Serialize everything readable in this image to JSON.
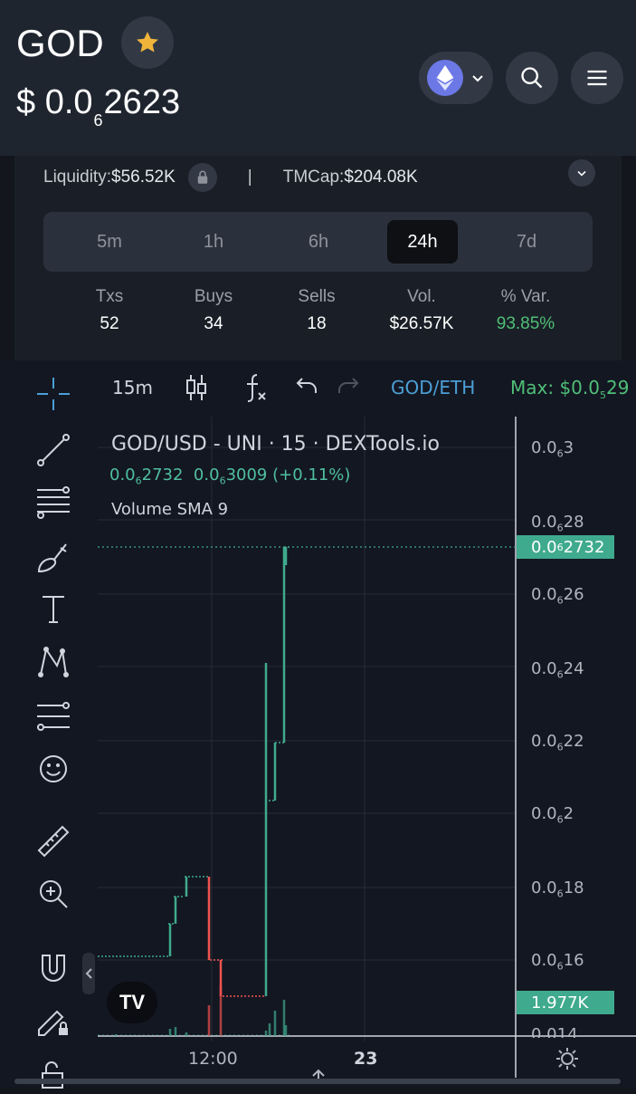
{
  "header": {
    "token": "GOD",
    "price_prefix": "$ 0.0",
    "price_sub": "6",
    "price_rest": "2623",
    "icons": [
      "star-icon",
      "ethereum-icon",
      "chevron-down-icon",
      "search-icon",
      "menu-icon"
    ]
  },
  "info": {
    "liquidity_label": "Liquidity:",
    "liquidity_value": "$56.52K",
    "separator": "|",
    "tmcap_label": "TMCap:",
    "tmcap_value": "$204.08K"
  },
  "timeframes": {
    "items": [
      "5m",
      "1h",
      "6h",
      "24h",
      "7d"
    ],
    "active": "24h"
  },
  "stats": [
    {
      "label": "Txs",
      "value": "52"
    },
    {
      "label": "Buys",
      "value": "34"
    },
    {
      "label": "Sells",
      "value": "18"
    },
    {
      "label": "Vol.",
      "value": "$26.57K"
    },
    {
      "label": "% Var.",
      "value": "93.85%"
    }
  ],
  "chart_toolbar": {
    "interval": "15m",
    "pair": "GOD/ETH",
    "max_label": "Max: $0.0",
    "max_sub": "5",
    "max_rest": "29"
  },
  "chart": {
    "legend_title": "GOD/USD - UNI · 15 · DEXTools.io",
    "legend_o_prefix": "0.0",
    "legend_o_sub": "6",
    "legend_o_rest": "2732",
    "legend_c_prefix": "0.0",
    "legend_c_sub": "6",
    "legend_c_rest": "3009",
    "legend_change": "(+0.11%)",
    "volume_label": "Volume SMA 9",
    "last_price_prefix": "0.0",
    "last_price_sub": "6",
    "last_price_rest": "2732",
    "volume_tag": "1.977K",
    "x_labels": [
      "12:00",
      "23"
    ],
    "y_labels": [
      {
        "prefix": "0.0",
        "sub": "6",
        "rest": "3"
      },
      {
        "prefix": "0.0",
        "sub": "6",
        "rest": "28"
      },
      {
        "prefix": "0.0",
        "sub": "6",
        "rest": "26"
      },
      {
        "prefix": "0.0",
        "sub": "6",
        "rest": "24"
      },
      {
        "prefix": "0.0",
        "sub": "6",
        "rest": "22"
      },
      {
        "prefix": "0.0",
        "sub": "6",
        "rest": "2"
      },
      {
        "prefix": "0.0",
        "sub": "6",
        "rest": "18"
      },
      {
        "prefix": "0.0",
        "sub": "6",
        "rest": "16"
      },
      {
        "prefix": "0.0",
        "sub": "",
        "rest": "14"
      }
    ],
    "logo": "TV"
  },
  "colors": {
    "up": "#3faa8d",
    "down": "#ef5350",
    "accent_green": "#4fbf77",
    "pair_blue": "#4c9fd6"
  }
}
